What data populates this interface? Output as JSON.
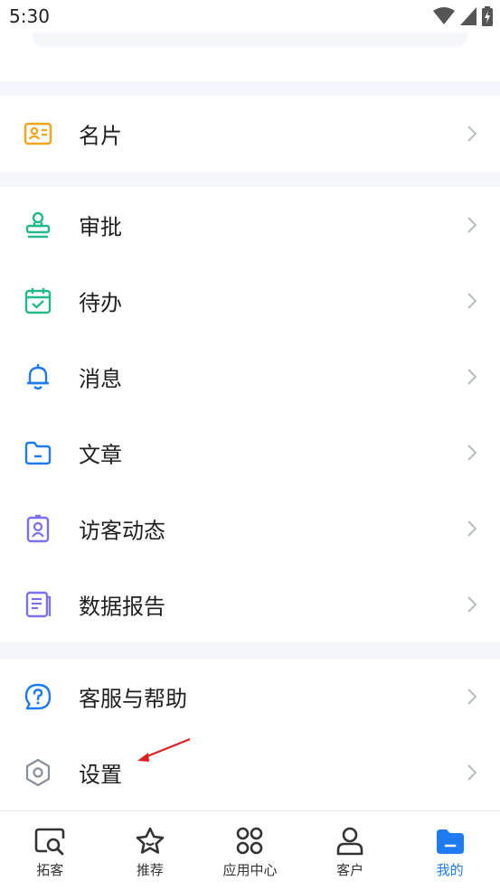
{
  "status": {
    "time": "5:30"
  },
  "menu": {
    "card": {
      "label": "名片",
      "icon": "id-card-icon"
    },
    "approve": {
      "label": "审批",
      "icon": "stamp-icon"
    },
    "todo": {
      "label": "待办",
      "icon": "calendar-check-icon"
    },
    "messages": {
      "label": "消息",
      "icon": "bell-icon"
    },
    "articles": {
      "label": "文章",
      "icon": "folder-icon"
    },
    "visitors": {
      "label": "访客动态",
      "icon": "visitor-badge-icon"
    },
    "reports": {
      "label": "数据报告",
      "icon": "report-book-icon"
    },
    "support": {
      "label": "客服与帮助",
      "icon": "help-bubble-icon"
    },
    "settings": {
      "label": "设置",
      "icon": "hexagon-settings-icon"
    }
  },
  "tabs": {
    "prospect": "拓客",
    "recommend": "推荐",
    "apps": "应用中心",
    "customers": "客户",
    "mine": "我的"
  },
  "colors": {
    "accent": "#1e7bf2",
    "orange": "#f5a31a",
    "green": "#23b98a",
    "purple": "#7b6ff2"
  }
}
